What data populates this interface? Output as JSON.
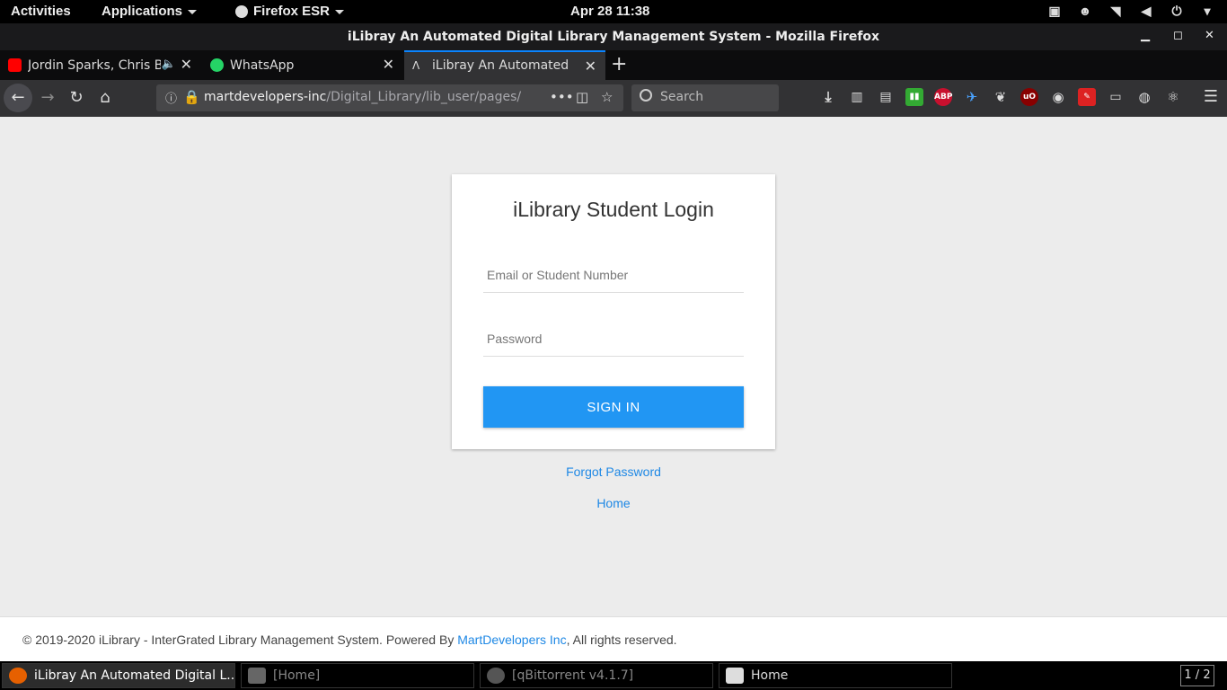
{
  "topbar": {
    "activities": "Activities",
    "applications": "Applications",
    "firefox": "Firefox ESR",
    "datetime": "Apr 28  11:38"
  },
  "window": {
    "title": "iLibray An Automated Digital Library Management System - Mozilla Firefox"
  },
  "tabs": [
    {
      "label": "Jordin Sparks, Chris Brown",
      "icon": "youtube-icon",
      "color": "#ff0000"
    },
    {
      "label": "WhatsApp",
      "icon": "whatsapp-icon",
      "color": "#25d366"
    },
    {
      "label": "iLibray An Automated Digital",
      "icon": "page-icon",
      "color": "#444444"
    }
  ],
  "url": {
    "host": "martdevelopers-inc",
    "path": "/Digital_Library/lib_user/pages/"
  },
  "search": {
    "placeholder": "Search"
  },
  "login": {
    "title": "iLibrary Student Login",
    "email_placeholder": "Email or Student Number",
    "password_placeholder": "Password",
    "signin": "SIGN IN",
    "forgot": "Forgot Password",
    "home": "Home"
  },
  "footer": {
    "prefix": "© 2019-2020 iLibrary - InterGrated Library Management System. Powered By ",
    "link": "MartDevelopers Inc",
    "suffix": ", All rights reserved."
  },
  "taskbar": {
    "items": [
      "iLibray An Automated Digital L...",
      "[Home]",
      "[qBittorrent v4.1.7]",
      "Home"
    ],
    "pager": "1 / 2"
  },
  "colors": {
    "accent": "#2196f3",
    "link": "#1e88e5"
  }
}
